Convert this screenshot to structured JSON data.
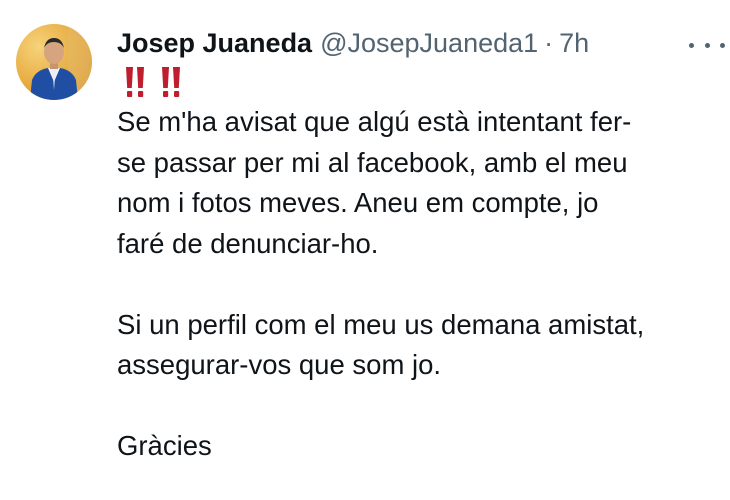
{
  "tweet": {
    "author": {
      "display_name": "Josep Juaneda",
      "handle": "@JosepJuaneda1",
      "avatar_icon": "avatar-photo"
    },
    "separator": "·",
    "time": "7h",
    "more_icon": "more-horizontal-icon",
    "alert_emoji": "‼️ ‼️",
    "paragraphs": [
      [
        "Se m'ha avisat que algú està intentant fer-",
        "se passar per mi al facebook, amb el meu",
        "nom i fotos meves. Aneu em compte, jo",
        "faré de denunciar-ho."
      ],
      [
        "Si un perfil com el meu us demana amistat,",
        "assegurar-vos que som jo."
      ],
      [
        "Gràcies"
      ]
    ]
  }
}
